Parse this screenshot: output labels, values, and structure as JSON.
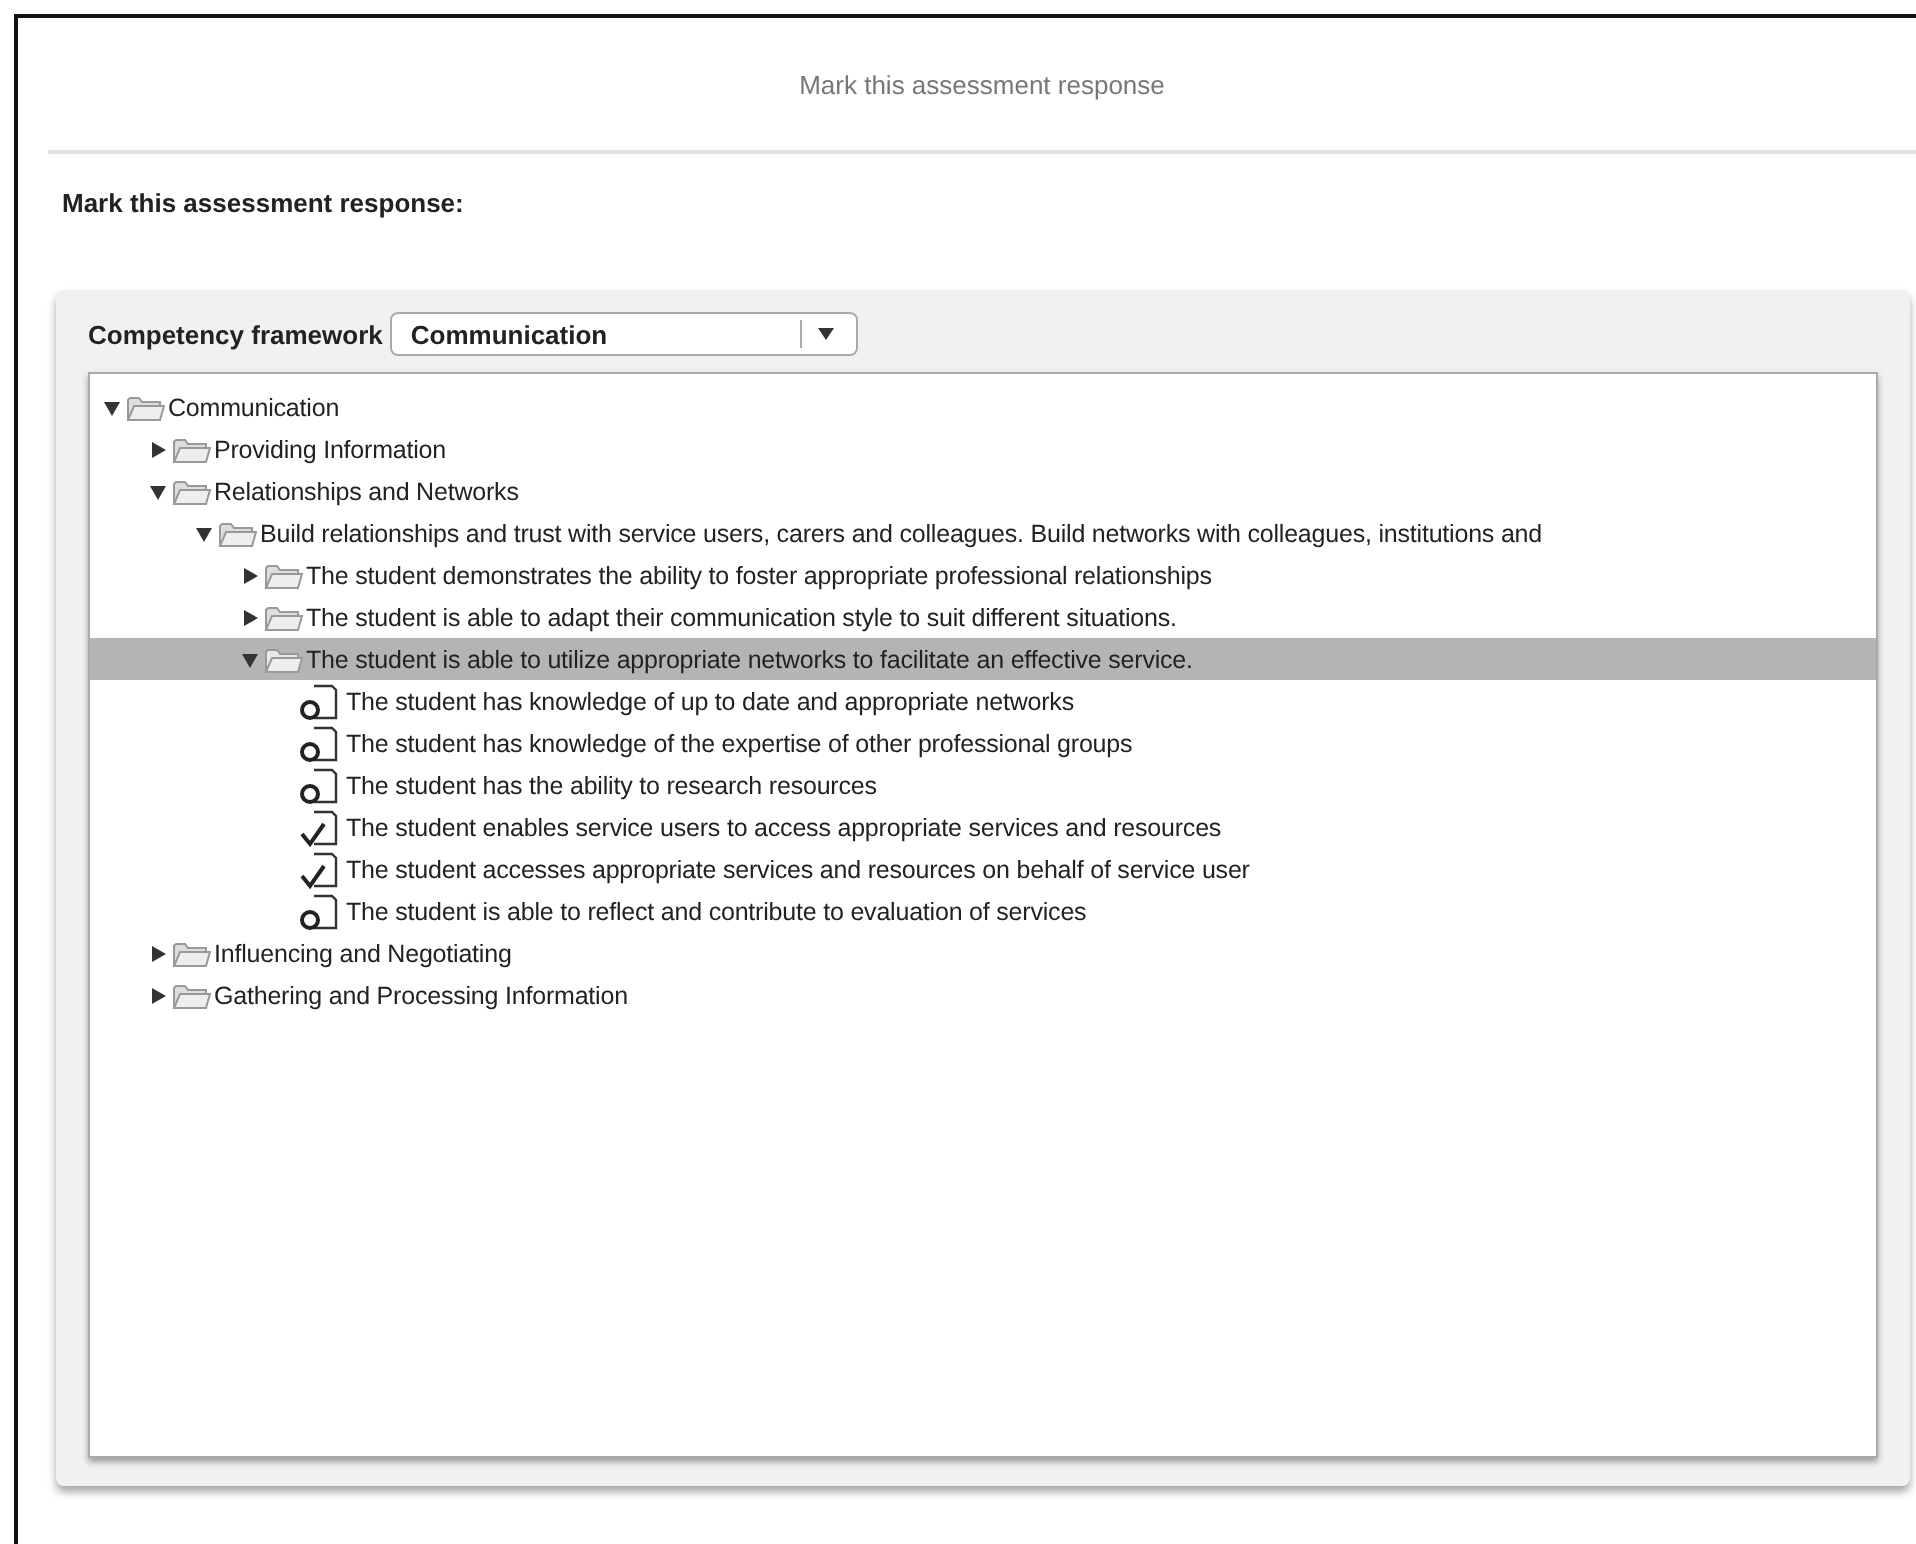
{
  "window": {
    "title": "Mark this assessment response"
  },
  "heading": "Mark this assessment response:",
  "framework": {
    "label": "Competency framework",
    "value": "Communication"
  },
  "tree": [
    {
      "kind": "folder",
      "label": "Communication",
      "expanded": true,
      "selected": false,
      "children": [
        {
          "kind": "folder",
          "label": "Providing Information",
          "expanded": false,
          "selected": false
        },
        {
          "kind": "folder",
          "label": "Relationships and Networks",
          "expanded": true,
          "selected": false,
          "children": [
            {
              "kind": "folder",
              "label": "Build relationships and trust with service users, carers and colleagues. Build networks with colleagues, institutions and",
              "expanded": true,
              "selected": false,
              "children": [
                {
                  "kind": "folder",
                  "label": "The student demonstrates the ability to foster appropriate professional relationships",
                  "expanded": false,
                  "selected": false
                },
                {
                  "kind": "folder",
                  "label": "The student is able to adapt their communication style to suit different situations.",
                  "expanded": false,
                  "selected": false
                },
                {
                  "kind": "folder",
                  "label": "The student is able to utilize appropriate networks to facilitate an effective service.",
                  "expanded": true,
                  "selected": true,
                  "children": [
                    {
                      "kind": "criterion",
                      "label": "The student has knowledge of up to date and appropriate networks",
                      "checked": false,
                      "selected": false
                    },
                    {
                      "kind": "criterion",
                      "label": "The student has knowledge of the expertise of other professional groups",
                      "checked": false,
                      "selected": false
                    },
                    {
                      "kind": "criterion",
                      "label": "The student has the ability to research resources",
                      "checked": false,
                      "selected": false
                    },
                    {
                      "kind": "criterion",
                      "label": "The student enables service users to access appropriate services and resources",
                      "checked": true,
                      "selected": false
                    },
                    {
                      "kind": "criterion",
                      "label": "The student accesses appropriate services and resources on behalf of service user",
                      "checked": true,
                      "selected": false
                    },
                    {
                      "kind": "criterion",
                      "label": "The student is able to reflect and contribute to evaluation of services",
                      "checked": false,
                      "selected": false
                    }
                  ]
                }
              ]
            }
          ]
        },
        {
          "kind": "folder",
          "label": "Influencing and Negotiating",
          "expanded": false,
          "selected": false
        },
        {
          "kind": "folder",
          "label": "Gathering and Processing Information",
          "expanded": false,
          "selected": false
        }
      ]
    }
  ]
}
